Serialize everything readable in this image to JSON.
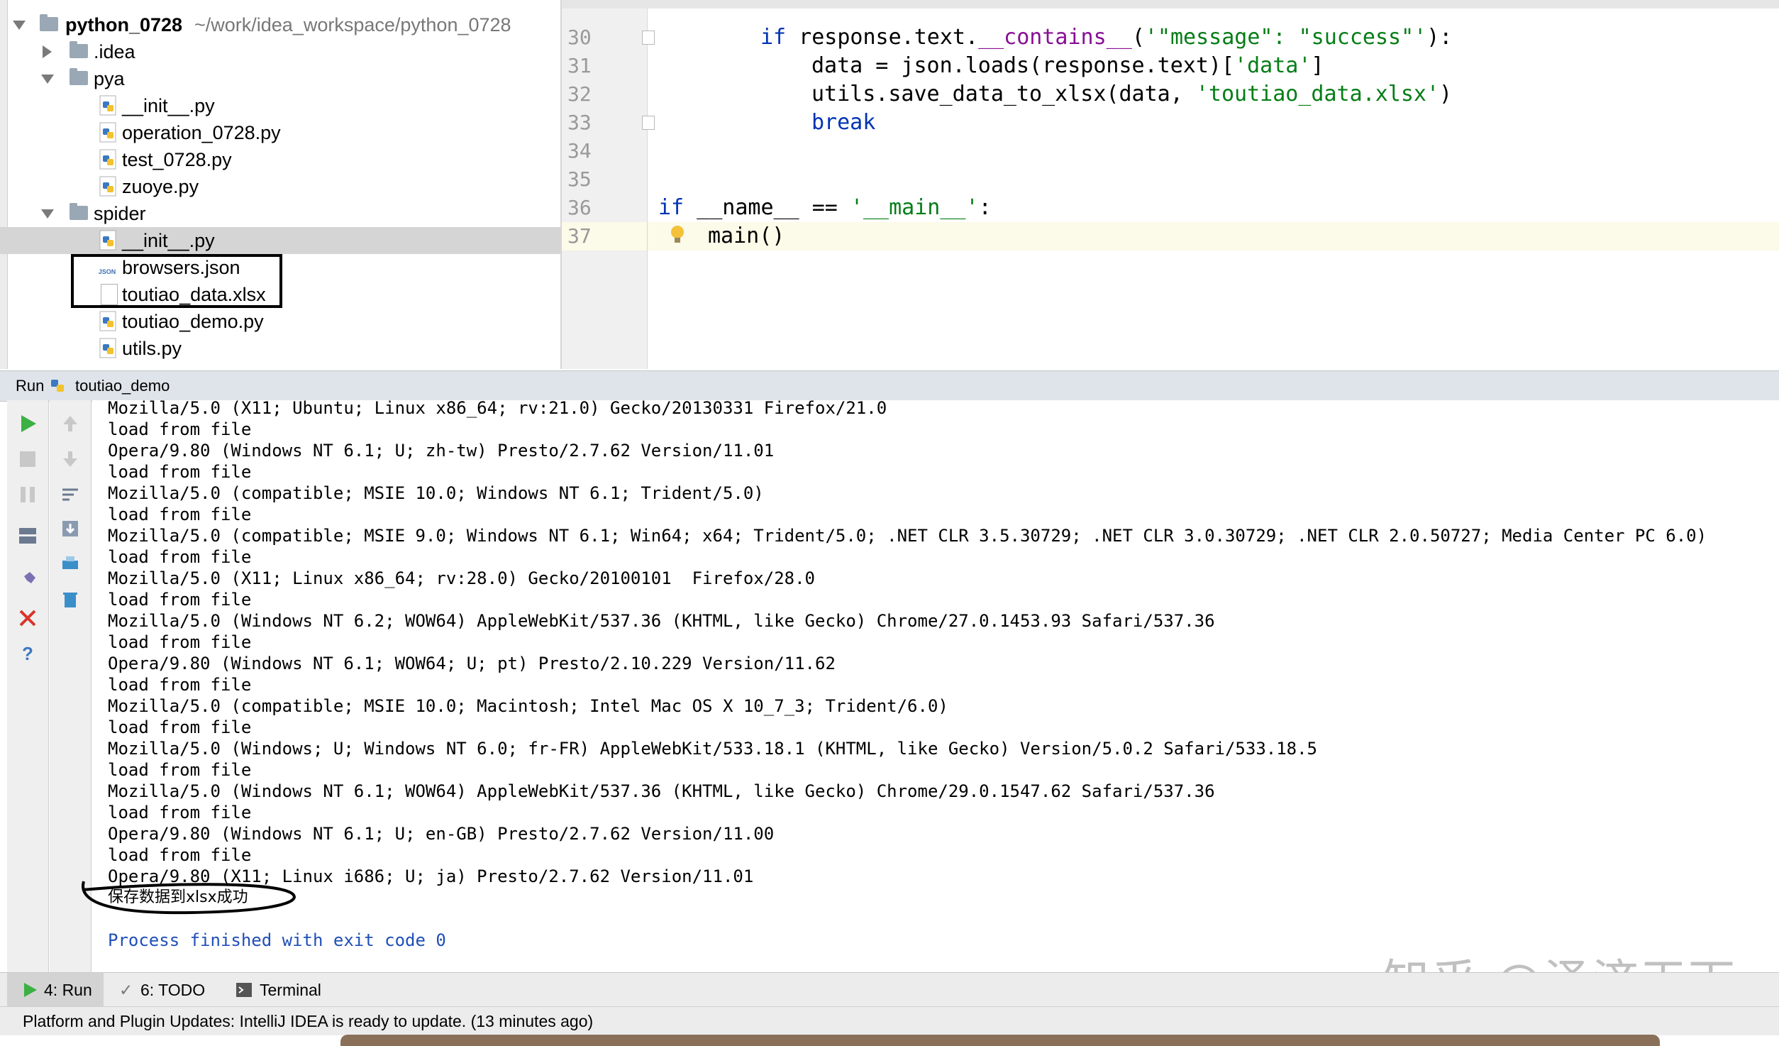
{
  "project": {
    "root_name": "python_0728",
    "root_path": "~/work/idea_workspace/python_0728",
    "items": [
      {
        "label": ".idea",
        "kind": "folder",
        "expanded": false
      },
      {
        "label": "pya",
        "kind": "folder",
        "expanded": true
      },
      {
        "label": "__init__.py",
        "kind": "py"
      },
      {
        "label": "operation_0728.py",
        "kind": "py"
      },
      {
        "label": "test_0728.py",
        "kind": "py"
      },
      {
        "label": "zuoye.py",
        "kind": "py"
      },
      {
        "label": "spider",
        "kind": "folder",
        "expanded": true
      },
      {
        "label": "__init__.py",
        "kind": "py",
        "selected": true
      },
      {
        "label": "browsers.json",
        "kind": "json"
      },
      {
        "label": "toutiao_data.xlsx",
        "kind": "file"
      },
      {
        "label": "toutiao_demo.py",
        "kind": "py"
      },
      {
        "label": "utils.py",
        "kind": "py"
      }
    ]
  },
  "editor": {
    "line_numbers": [
      "30",
      "31",
      "32",
      "33",
      "34",
      "35",
      "36",
      "37"
    ],
    "lines": {
      "l30_kw": "if",
      "l30_a": " response.text.",
      "l30_mag": "__contains__",
      "l30_b": "(",
      "l30_str": "'\"message\": \"success\"'",
      "l30_c": "):",
      "l31_a": "data = json.loads(response.text)[",
      "l31_str": "'data'",
      "l31_b": "]",
      "l32_a": "utils.save_data_to_xlsx(data, ",
      "l32_str": "'toutiao_data.xlsx'",
      "l32_b": ")",
      "l33_kw": "break",
      "l36_kw": "if",
      "l36_a": " __name__ == ",
      "l36_str": "'__main__'",
      "l36_b": ":",
      "l37_a": "main()"
    }
  },
  "run": {
    "label": "Run",
    "config_name": "toutiao_demo",
    "output": [
      "Mozilla/5.0 (X11; Ubuntu; Linux x86_64; rv:21.0) Gecko/20130331 Firefox/21.0",
      "load from file",
      "Opera/9.80 (Windows NT 6.1; U; zh-tw) Presto/2.7.62 Version/11.01",
      "load from file",
      "Mozilla/5.0 (compatible; MSIE 10.0; Windows NT 6.1; Trident/5.0)",
      "load from file",
      "Mozilla/5.0 (compatible; MSIE 9.0; Windows NT 6.1; Win64; x64; Trident/5.0; .NET CLR 3.5.30729; .NET CLR 3.0.30729; .NET CLR 2.0.50727; Media Center PC 6.0)",
      "load from file",
      "Mozilla/5.0 (X11; Linux x86_64; rv:28.0) Gecko/20100101  Firefox/28.0",
      "load from file",
      "Mozilla/5.0 (Windows NT 6.2; WOW64) AppleWebKit/537.36 (KHTML, like Gecko) Chrome/27.0.1453.93 Safari/537.36",
      "load from file",
      "Opera/9.80 (Windows NT 6.1; WOW64; U; pt) Presto/2.10.229 Version/11.62",
      "load from file",
      "Mozilla/5.0 (compatible; MSIE 10.0; Macintosh; Intel Mac OS X 10_7_3; Trident/6.0)",
      "load from file",
      "Mozilla/5.0 (Windows; U; Windows NT 6.0; fr-FR) AppleWebKit/533.18.1 (KHTML, like Gecko) Version/5.0.2 Safari/533.18.5",
      "load from file",
      "Mozilla/5.0 (Windows NT 6.1; WOW64) AppleWebKit/537.36 (KHTML, like Gecko) Chrome/29.0.1547.62 Safari/537.36",
      "load from file",
      "Opera/9.80 (Windows NT 6.1; U; en-GB) Presto/2.7.62 Version/11.00",
      "load from file",
      "Opera/9.80 (X11; Linux i686; U; ja) Presto/2.7.62 Version/11.01",
      "保存数据到xlsx成功"
    ],
    "exit_message": "Process finished with exit code 0"
  },
  "bottom_tabs": {
    "run": "4: Run",
    "todo": "6: TODO",
    "terminal": "Terminal"
  },
  "status": {
    "message": "Platform and Plugin Updates: IntelliJ IDEA is ready to update. (13 minutes ago)"
  },
  "watermark": "知乎 @泽济天下",
  "colors": {
    "keyword": "#0033b3",
    "string": "#067d17",
    "dunder": "#871094",
    "run_green": "#3cb043",
    "stop_red": "#d9342b",
    "process_blue": "#1f4fb8"
  }
}
